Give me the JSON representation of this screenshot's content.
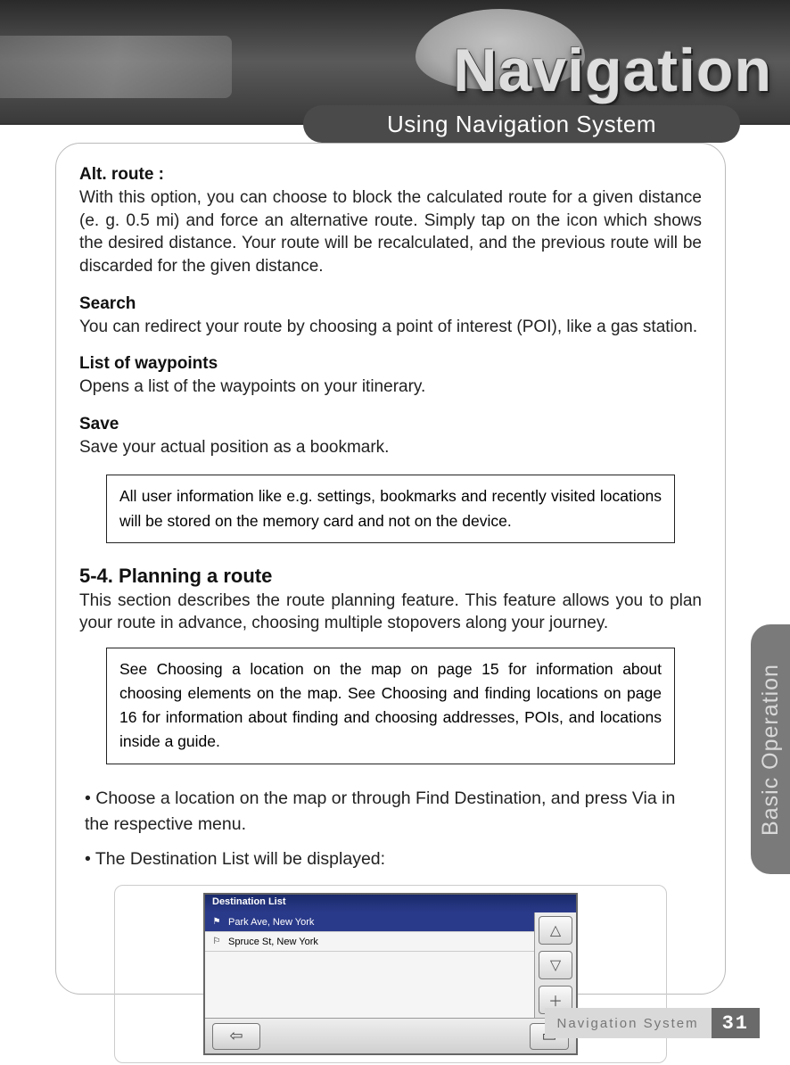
{
  "banner": {
    "title": "Navigation",
    "section": "Using Navigation System"
  },
  "sideTab": "Basic Operation",
  "options": {
    "altRoute": {
      "heading": "Alt. route :",
      "body": "With this option, you can choose to block the calculated route for a given distance (e. g. 0.5 mi) and force an alternative route. Simply tap on the icon which shows the desired distance. Your route will be recalculated, and the previous route will be discarded for the given distance."
    },
    "search": {
      "heading": "Search",
      "body": "You can redirect your route by choosing a point of interest (POI), like a gas station."
    },
    "waypoints": {
      "heading": "List of waypoints",
      "body": "Opens a list of the waypoints on your itinerary."
    },
    "save": {
      "heading": "Save",
      "body": "Save your actual position as a bookmark."
    }
  },
  "note1": "All user information like e.g. settings, bookmarks and recently visited locations will be stored on the memory card and not on the device.",
  "section": {
    "heading": "5-4. Planning a route",
    "intro": "This section describes the route planning feature. This feature allows you to plan your route in advance, choosing multiple stopovers along your journey."
  },
  "note2": "See  Choosing a location on the map  on page 15 for information about choosing elements on the map. See  Choosing and finding locations  on page 16 for information about finding and choosing addresses, POIs, and locations inside a guide.",
  "bullets": [
    "• Choose a location on the map or through Find Destination, and press Via in the respective menu.",
    "• The Destination List will be displayed:"
  ],
  "destList": {
    "title": "Destination List",
    "rows": [
      "Park Ave, New York",
      "Spruce St, New York"
    ]
  },
  "footer": {
    "label": "Navigation System",
    "page": "31"
  }
}
